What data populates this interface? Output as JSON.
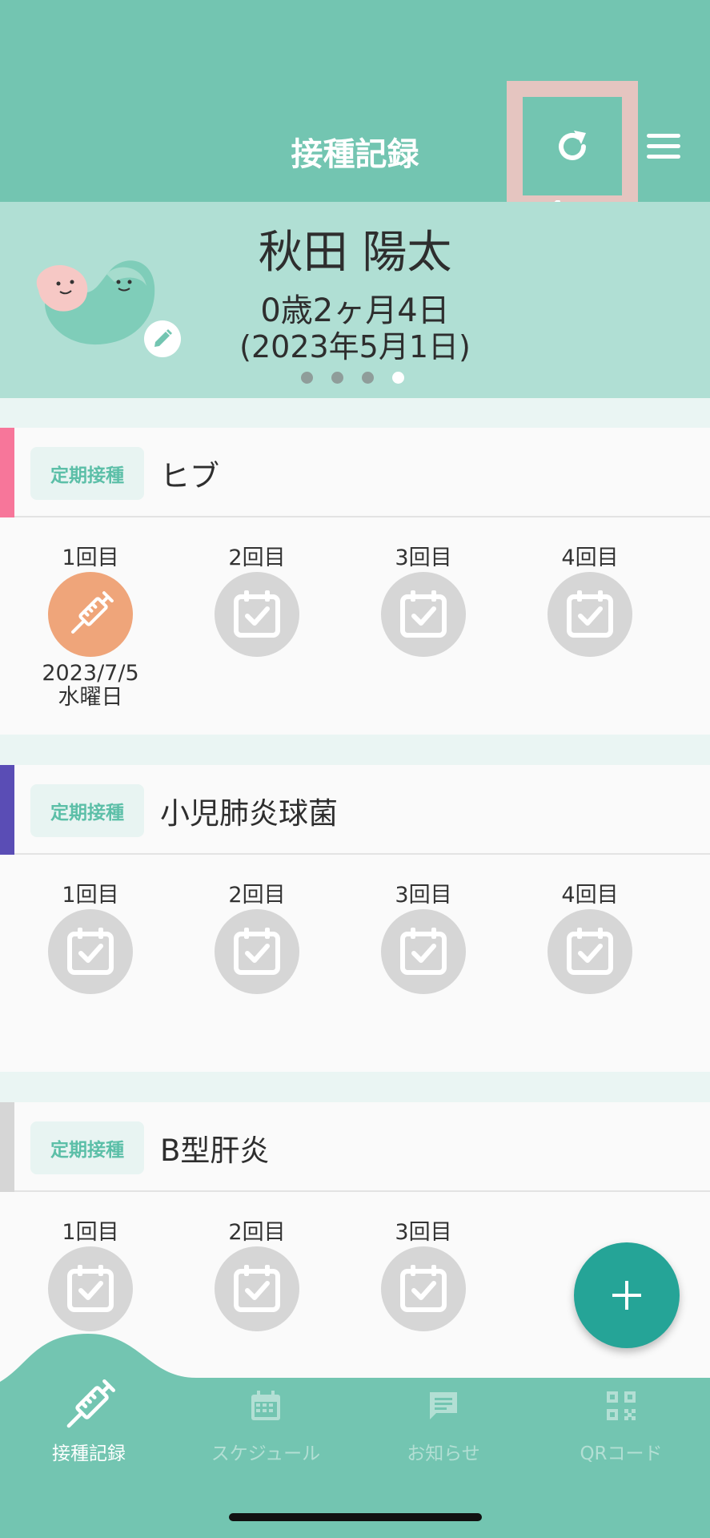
{
  "header": {
    "title": "接種記録",
    "refresh_icon": "refresh-icon",
    "menu_icon": "hamburger-menu-icon",
    "background": "#73c5b1",
    "highlight_color": "#e5c5c0"
  },
  "profile": {
    "name": "秋田 陽太",
    "age": "0歳2ヶ月4日",
    "birth": "(2023年5月1日)",
    "page_count": 4,
    "active_page": 4,
    "edit_icon": "pencil-icon"
  },
  "vaccines": [
    {
      "tag": "定期接種",
      "name": "ヒブ",
      "color": "#f7769a",
      "doses": [
        {
          "label": "1回目",
          "status": "done",
          "date": "2023/7/5",
          "weekday": "水曜日"
        },
        {
          "label": "2回目",
          "status": "scheduled"
        },
        {
          "label": "3回目",
          "status": "scheduled"
        },
        {
          "label": "4回目",
          "status": "scheduled"
        }
      ]
    },
    {
      "tag": "定期接種",
      "name": "小児肺炎球菌",
      "color": "#5a4db5",
      "doses": [
        {
          "label": "1回目",
          "status": "scheduled"
        },
        {
          "label": "2回目",
          "status": "scheduled"
        },
        {
          "label": "3回目",
          "status": "scheduled"
        },
        {
          "label": "4回目",
          "status": "scheduled"
        }
      ]
    },
    {
      "tag": "定期接種",
      "name": "B型肝炎",
      "color": "#d6d6d6",
      "doses": [
        {
          "label": "1回目",
          "status": "scheduled"
        },
        {
          "label": "2回目",
          "status": "scheduled"
        },
        {
          "label": "3回目",
          "status": "scheduled"
        }
      ]
    }
  ],
  "fab": {
    "icon": "plus-icon",
    "color": "#25a497"
  },
  "tabs": [
    {
      "label": "接種記録",
      "icon": "syringe-icon",
      "active": true
    },
    {
      "label": "スケジュール",
      "icon": "calendar-icon",
      "active": false
    },
    {
      "label": "お知らせ",
      "icon": "message-icon",
      "active": false
    },
    {
      "label": "QRコード",
      "icon": "qr-code-icon",
      "active": false
    }
  ]
}
